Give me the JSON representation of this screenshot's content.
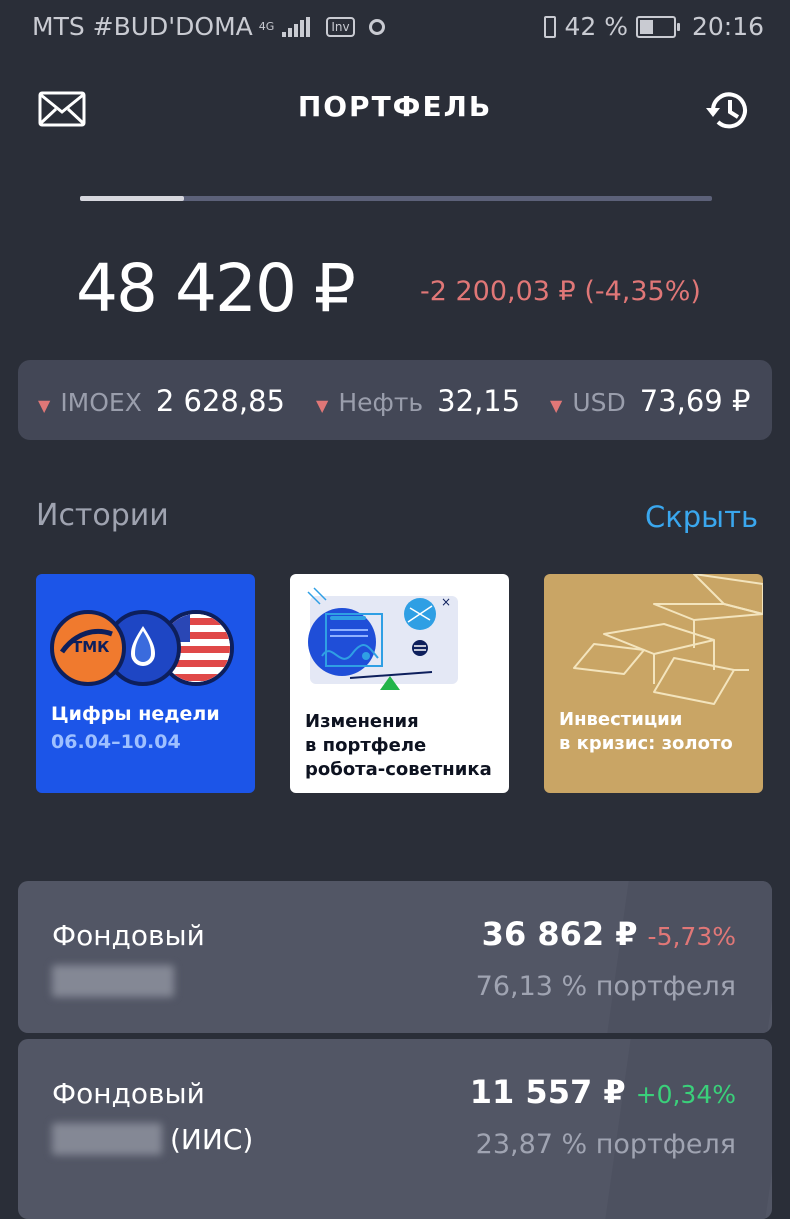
{
  "status_bar": {
    "carrier": "MTS #BUD'DOMA",
    "net_type": "4G",
    "app_badge": "Inv",
    "battery": "42 %",
    "time": "20:16"
  },
  "header": {
    "title": "ПОРТФЕЛЬ"
  },
  "story_progress": 0.165,
  "summary": {
    "balance": "48 420 ₽",
    "change": "-2 200,03 ₽ (-4,35%)"
  },
  "tickers": [
    {
      "name": "IMOEX",
      "value": "2 628,85",
      "direction": "down"
    },
    {
      "name": "Нефть",
      "value": "32,15",
      "direction": "down"
    },
    {
      "name": "USD",
      "value": "73,69 ₽",
      "direction": "down"
    }
  ],
  "stories": {
    "title": "Истории",
    "hide_label": "Скрыть",
    "items": [
      {
        "line1": "Цифры недели",
        "line2": "06.04–10.04",
        "logo": "ТМК",
        "bg": "#1c55e8"
      },
      {
        "line1": "Изменения",
        "line2": "в портфеле",
        "line3": "робота-советника",
        "bg": "#ffffff"
      },
      {
        "line1": "Инвестиции",
        "line2": "в кризис: золото",
        "bg": "#c9a565"
      }
    ]
  },
  "portfolios": [
    {
      "name": "Фондовый",
      "suffix": "",
      "value": "36 862 ₽",
      "pct": "-5,73%",
      "share": "76,13 % портфеля",
      "pct_color": "#e07777"
    },
    {
      "name": "Фондовый",
      "suffix": "(ИИС)",
      "value": "11 557 ₽",
      "pct": "+0,34%",
      "share": "23,87 % портфеля",
      "pct_color": "#3ad07a"
    }
  ],
  "colors": {
    "background": "#2a2e38",
    "negative": "#e07777",
    "positive": "#3ad07a",
    "link": "#3aa7ee"
  }
}
